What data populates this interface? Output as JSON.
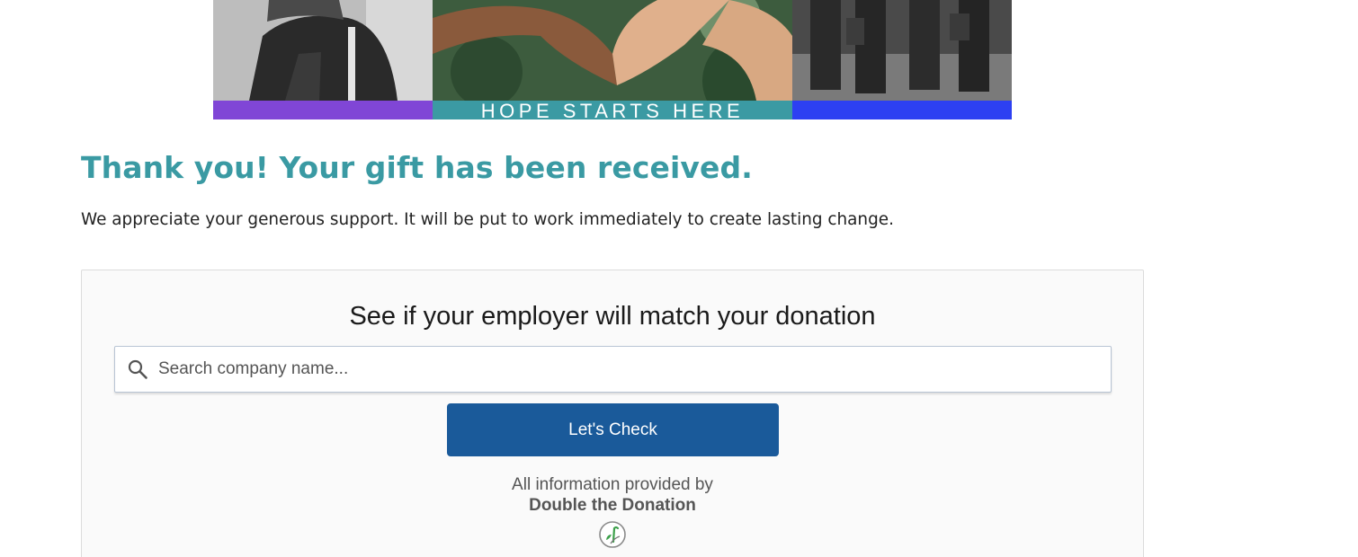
{
  "banner": {
    "tagline": "HOPE STARTS HERE",
    "colors": {
      "left_strip": "#8046d6",
      "middle_strip": "#3b9aa3",
      "right_strip": "#2d40f2"
    }
  },
  "confirmation": {
    "heading": "Thank you! Your gift has been received.",
    "message": "We appreciate your generous support. It will be put to work immediately to create lasting change."
  },
  "matching_widget": {
    "title": "See if your employer will match your donation",
    "search": {
      "placeholder": "Search company name...",
      "value": "",
      "icon": "search-icon"
    },
    "button_label": "Let's Check",
    "provided_by_text": "All information provided by",
    "provider_name": "Double the Donation",
    "provider_logo_icon": "double-the-donation-logo"
  },
  "colors": {
    "accent": "#3a9aa3",
    "button": "#1a5a9a",
    "text": "#222222"
  }
}
